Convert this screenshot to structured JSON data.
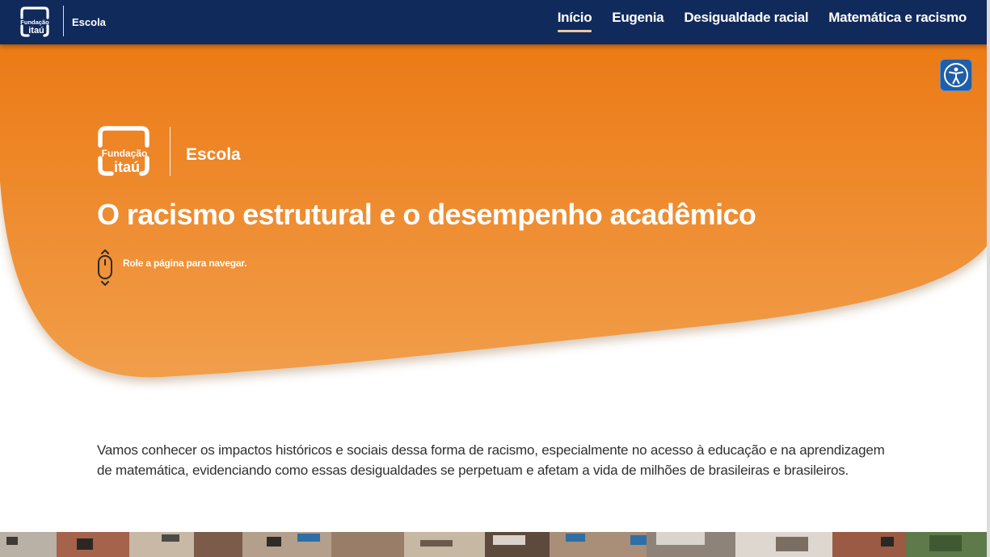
{
  "header": {
    "brand_name": "Fundação Itaú",
    "section": "Escola",
    "nav": [
      {
        "label": "Início",
        "active": true
      },
      {
        "label": "Eugenia",
        "active": false
      },
      {
        "label": "Desigualdade racial",
        "active": false
      },
      {
        "label": "Matemática e racismo",
        "active": false
      }
    ]
  },
  "hero": {
    "logo_text_line1": "Fundação",
    "logo_text_line2": "itaú",
    "section": "Escola",
    "title": "O racismo estrutural e o desempenho acadêmico",
    "scroll_hint": "Role a página para navegar."
  },
  "accessibility": {
    "icon": "accessibility-icon"
  },
  "intro": {
    "text": "Vamos conhecer os impactos históricos e sociais dessa forma de racismo, especialmente no acesso à educação e na aprendizagem de matemática, evidenciando como essas desigualdades se perpetuam e afetam a vida de milhões de brasileiras e brasileiros."
  },
  "colors": {
    "nav_bg": "#112a5c",
    "hero_orange_top": "#ec7a16",
    "hero_orange_bottom": "#f19a45",
    "accent_underline": "#e9c9a6",
    "a11y_blue": "#1f5ea8"
  }
}
